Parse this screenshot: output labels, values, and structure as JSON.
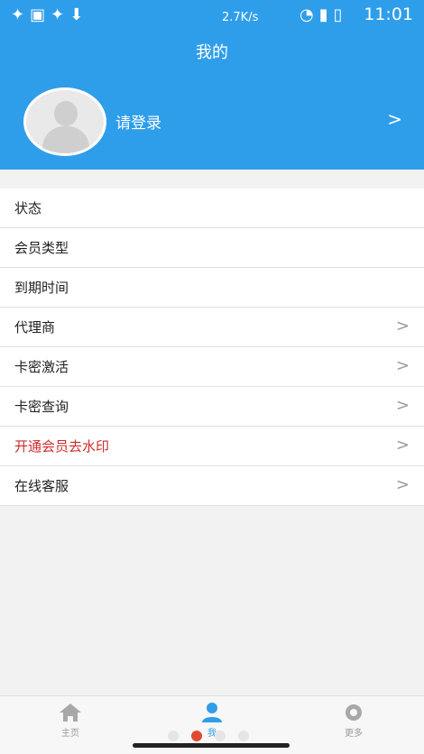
{
  "statusbar": {
    "left_icons": [
      "bug-icon",
      "image-icon",
      "bug-icon",
      "download-icon"
    ],
    "net_speed": "2.7K/s",
    "time": "11:01"
  },
  "header": {
    "title": "我的",
    "login_label": "请登录",
    "chevron": ">"
  },
  "menu": {
    "items": [
      {
        "label": "状态",
        "chevron": false
      },
      {
        "label": "会员类型",
        "chevron": false
      },
      {
        "label": "到期时间",
        "chevron": false
      },
      {
        "label": "代理商",
        "chevron": true
      },
      {
        "label": "卡密激活",
        "chevron": true
      },
      {
        "label": "卡密查询",
        "chevron": true
      },
      {
        "label": "开通会员去水印",
        "chevron": true,
        "highlight": "#d12b2b"
      },
      {
        "label": "在线客服",
        "chevron": true
      }
    ],
    "chevron_glyph": ">"
  },
  "tabbar": {
    "tabs": [
      {
        "label": "主页",
        "icon": "home-icon"
      },
      {
        "label": "我",
        "icon": "user-icon",
        "active": true
      },
      {
        "label": "更多",
        "icon": "gear-icon"
      }
    ]
  },
  "colors": {
    "accent": "#2f9eea",
    "highlight": "#d12b2b"
  }
}
